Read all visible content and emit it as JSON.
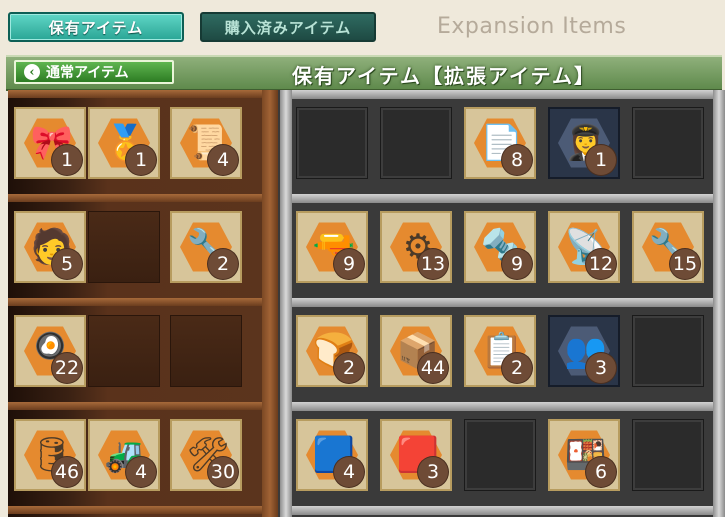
{
  "tabs": {
    "owned": "保有アイテム",
    "purchased": "購入済みアイテム"
  },
  "expansion_title": "Expansion Items",
  "banner": {
    "back_label": "通常アイテム",
    "title": "保有アイテム【拡張アイテム】"
  },
  "wood_rows": [
    [
      {
        "icon": "ribbon-icon",
        "glyph": "🎀",
        "count": "1"
      },
      {
        "icon": "medal-icon",
        "glyph": "🏅",
        "count": "1"
      },
      {
        "icon": "blueprint-icon",
        "glyph": "📜",
        "count": "4"
      }
    ],
    [
      {
        "icon": "maintenance-crew-icon",
        "glyph": "🧑",
        "count": "5"
      },
      null,
      {
        "icon": "engineer-icon",
        "glyph": "🔧",
        "count": "2"
      }
    ],
    [
      {
        "icon": "cook-icon",
        "glyph": "🍳",
        "count": "22"
      },
      null,
      null
    ],
    [
      {
        "icon": "drum-icon",
        "glyph": "🛢",
        "count": "46"
      },
      {
        "icon": "bulldozer-icon",
        "glyph": "🚜",
        "count": "4"
      },
      {
        "icon": "tools-icon",
        "glyph": "🛠",
        "count": "30"
      }
    ]
  ],
  "metal_rows": [
    [
      null,
      null,
      {
        "icon": "documents-icon",
        "glyph": "📄",
        "count": "8"
      },
      {
        "icon": "pilot-icon",
        "glyph": "👩‍✈️",
        "count": "1",
        "dark": true
      },
      null
    ],
    [
      {
        "icon": "turret-icon",
        "glyph": "🔫",
        "count": "9"
      },
      {
        "icon": "propeller-icon",
        "glyph": "⚙",
        "count": "13"
      },
      {
        "icon": "machine-gun-icon",
        "glyph": "🔩",
        "count": "9"
      },
      {
        "icon": "radar-crew-icon",
        "glyph": "📡",
        "count": "12"
      },
      {
        "icon": "engineer-wrench-icon",
        "glyph": "🔧",
        "count": "15"
      }
    ],
    [
      {
        "icon": "bread-icon",
        "glyph": "🍞",
        "count": "2"
      },
      {
        "icon": "materials-icon",
        "glyph": "📦",
        "count": "44"
      },
      {
        "icon": "report-icon",
        "glyph": "📋",
        "count": "2"
      },
      {
        "icon": "crew-icon",
        "glyph": "👥",
        "count": "3",
        "dark": true
      },
      null
    ],
    [
      {
        "icon": "blue-cloth-icon",
        "glyph": "🟦",
        "count": "4"
      },
      {
        "icon": "red-box-icon",
        "glyph": "🟥",
        "count": "3"
      },
      null,
      {
        "icon": "meal-icon",
        "glyph": "🍱",
        "count": "6"
      },
      null
    ]
  ]
}
